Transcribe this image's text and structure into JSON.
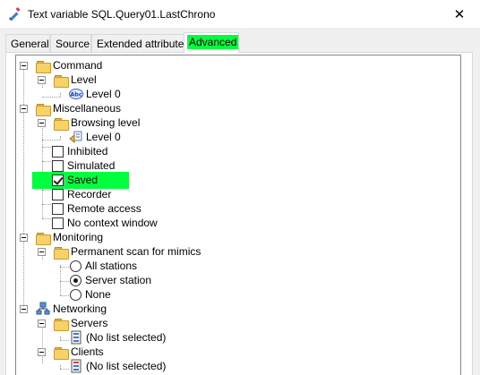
{
  "window": {
    "title": "Text variable SQL.Query01.LastChrono",
    "close_glyph": "✕"
  },
  "tabs": [
    {
      "label": "General"
    },
    {
      "label": "Source"
    },
    {
      "label": "Extended attributes"
    },
    {
      "label": "Advanced",
      "active": true
    }
  ],
  "tree": {
    "command": {
      "label": "Command",
      "level": {
        "label": "Level",
        "value": "Level 0",
        "icon": "abc-text-icon"
      }
    },
    "miscellaneous": {
      "label": "Miscellaneous",
      "browsing_level": {
        "label": "Browsing level",
        "value": "Level 0",
        "icon": "browse-level-icon"
      },
      "options": [
        {
          "label": "Inhibited",
          "checked": false
        },
        {
          "label": "Simulated",
          "checked": false
        },
        {
          "label": "Saved",
          "checked": true,
          "highlighted": true
        },
        {
          "label": "Recorder",
          "checked": false
        },
        {
          "label": "Remote access",
          "checked": false
        },
        {
          "label": "No context window",
          "checked": false
        }
      ]
    },
    "monitoring": {
      "label": "Monitoring",
      "permanent_scan": {
        "label": "Permanent scan for mimics",
        "choices": [
          {
            "label": "All stations",
            "selected": false
          },
          {
            "label": "Server station",
            "selected": true
          },
          {
            "label": "None",
            "selected": false
          }
        ]
      }
    },
    "networking": {
      "label": "Networking",
      "servers": {
        "label": "Servers",
        "value": "(No list selected)"
      },
      "clients": {
        "label": "Clients",
        "value": "(No list selected)"
      }
    }
  },
  "colors": {
    "highlight": "#00ff3c",
    "folder": "#f6d26a"
  }
}
